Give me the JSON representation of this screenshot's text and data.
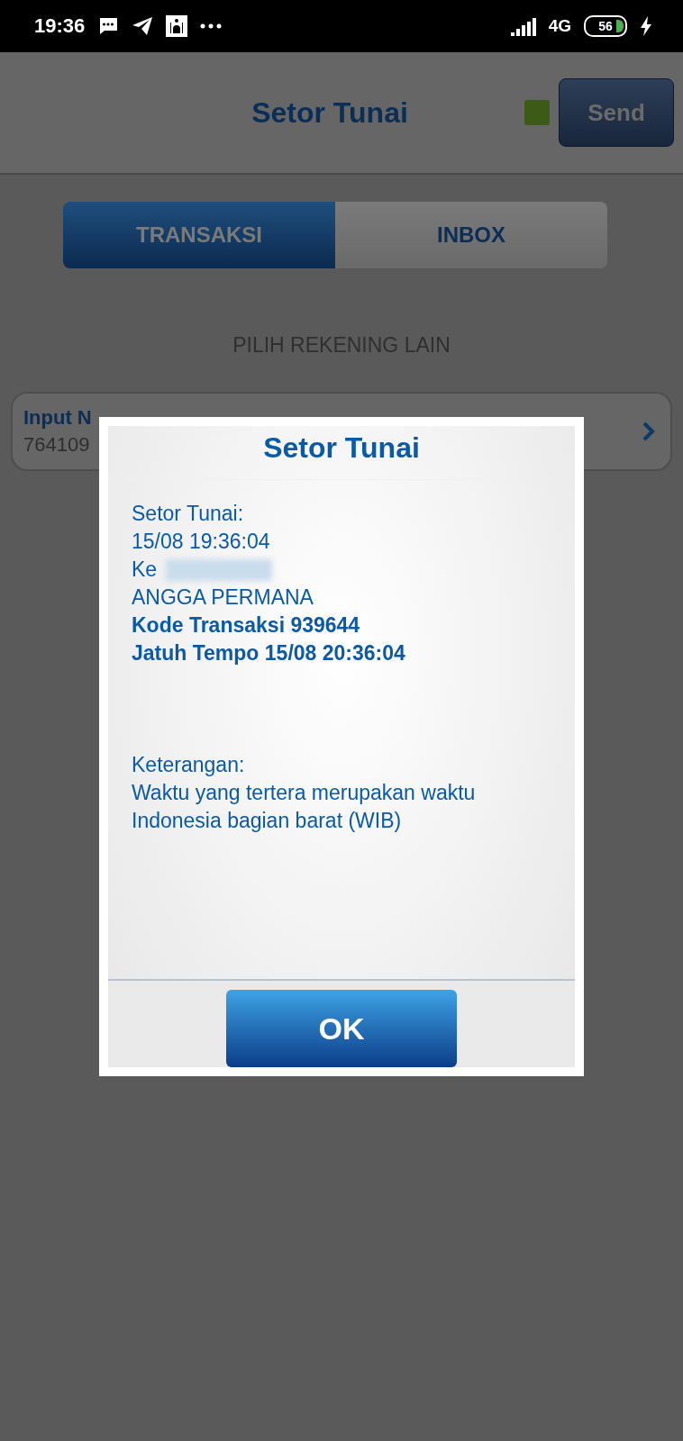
{
  "status_bar": {
    "time": "19:36",
    "network": "4G",
    "battery": "56"
  },
  "header": {
    "title": "Setor Tunai",
    "send_button": "Send"
  },
  "tabs": [
    {
      "label": "TRANSAKSI",
      "selected": true
    },
    {
      "label": "INBOX",
      "selected": false
    }
  ],
  "account_link": "PILIH REKENING LAIN",
  "account_card": {
    "label": "Input N",
    "value": "764109"
  },
  "dialog": {
    "title": "Setor Tunai",
    "lines": [
      {
        "text": "Setor Tunai:",
        "kind": "plain"
      },
      {
        "text": "15/08 19:36:04",
        "kind": "plain"
      },
      {
        "text": "Ke",
        "kind": "redacted"
      },
      {
        "text": "ANGGA PERMANA",
        "kind": "plain"
      },
      {
        "text": "Kode Transaksi 939644",
        "kind": "bold"
      },
      {
        "text": "Jatuh Tempo 15/08 20:36:04",
        "kind": "bold"
      },
      {
        "kind": "gap"
      },
      {
        "text": "Keterangan:",
        "kind": "plain"
      },
      {
        "text": "Waktu yang tertera merupakan waktu",
        "kind": "plain"
      },
      {
        "text": "Indonesia bagian barat (WIB)",
        "kind": "plain"
      }
    ],
    "ok_button": "OK"
  }
}
